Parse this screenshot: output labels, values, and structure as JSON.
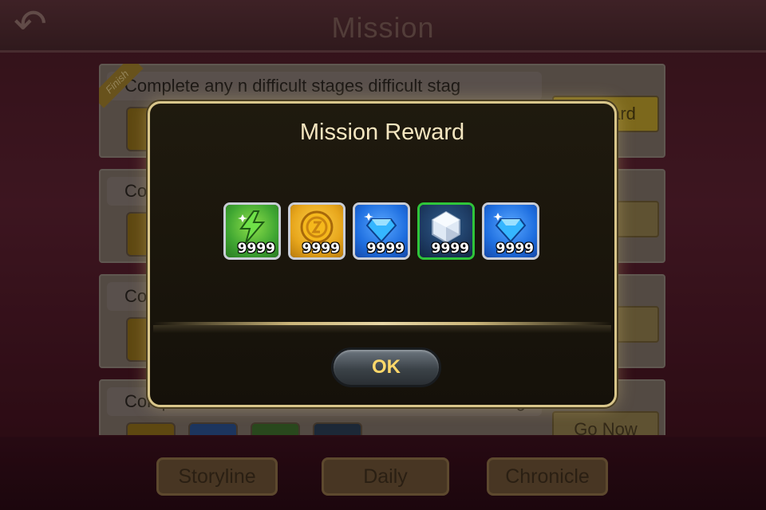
{
  "header": {
    "title": "Mission",
    "back_icon": "back-arrow-icon"
  },
  "missions": [
    {
      "description": "Complete any n difficult stages  difficult stag",
      "badge": "Finish",
      "button": "Reward",
      "status": "finished"
    },
    {
      "description": "Co",
      "button": "ow"
    },
    {
      "description": "Co",
      "button": "ow"
    },
    {
      "description": "Comp",
      "description_tail": "g",
      "button": "Go Now"
    }
  ],
  "tabs": [
    {
      "label": "Storyline"
    },
    {
      "label": "Daily"
    },
    {
      "label": "Chronicle"
    }
  ],
  "modal": {
    "title": "Mission Reward",
    "ok_label": "OK",
    "rewards": [
      {
        "icon": "energy-icon",
        "qty": "9999",
        "bg": "#3fa632"
      },
      {
        "icon": "gold-coin-icon",
        "qty": "9999",
        "bg": "#e7a61c"
      },
      {
        "icon": "blue-diamond-icon",
        "qty": "9999",
        "bg": "#1f6fe0"
      },
      {
        "icon": "crystal-icon",
        "qty": "9999",
        "bg": "#1e3c64",
        "border": "green"
      },
      {
        "icon": "blue-diamond-icon",
        "qty": "9999",
        "bg": "#1f6fe0"
      }
    ]
  },
  "colors": {
    "modal_border": "#d9c68b",
    "ok_text": "#ffd86a",
    "title_text": "#f5e6c0"
  }
}
